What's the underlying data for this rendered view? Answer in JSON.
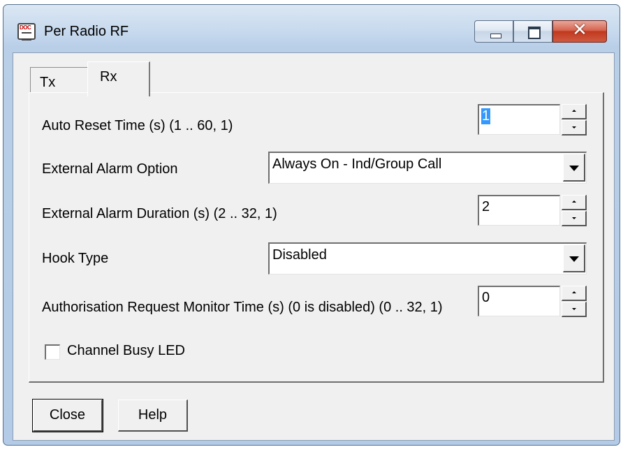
{
  "window": {
    "title": "Per Radio RF",
    "app_icon": "document-icon",
    "app_icon_text": "DOC",
    "controls": {
      "minimize": "minimize-icon",
      "maximize": "maximize-icon",
      "close": "close-icon",
      "close_glyph": "✕"
    }
  },
  "tabs": [
    {
      "label": "Tx",
      "active": false
    },
    {
      "label": "Rx",
      "active": true
    }
  ],
  "fields": {
    "auto_reset": {
      "label": "Auto Reset Time (s) (1 .. 60, 1)",
      "value": "1"
    },
    "ext_alarm_option": {
      "label": "External Alarm Option",
      "value": "Always On - Ind/Group Call"
    },
    "ext_alarm_duration": {
      "label": "External Alarm Duration (s) (2 .. 32, 1)",
      "value": "2"
    },
    "hook_type": {
      "label": "Hook Type",
      "value": "Disabled"
    },
    "auth_monitor": {
      "label": "Authorisation Request Monitor Time (s) (0 is disabled) (0 .. 32, 1)",
      "value": "0"
    },
    "channel_busy_led": {
      "label": "Channel Busy LED",
      "checked": false
    }
  },
  "buttons": {
    "close": "Close",
    "help": "Help"
  },
  "colors": {
    "selection": "#3399ff",
    "close_button": "#c0391f",
    "titlebar": "#c8daee"
  }
}
